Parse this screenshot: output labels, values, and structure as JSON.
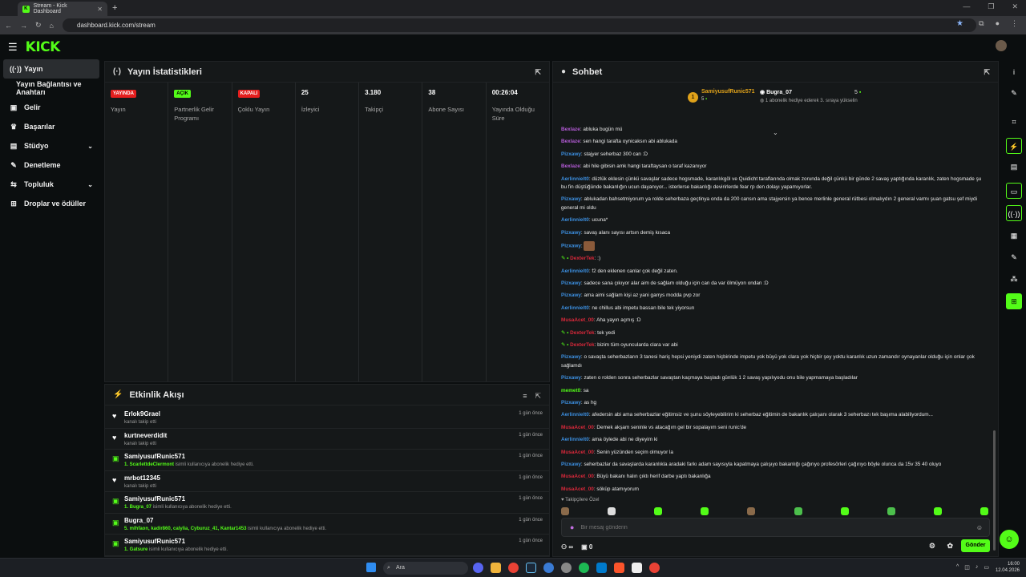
{
  "browser": {
    "tab_title": "Stream - Kick Dashboard",
    "url": "dashboard.kick.com/stream"
  },
  "header": {
    "logo": "KICK"
  },
  "sidebar": {
    "items": [
      {
        "label": "Yayın",
        "icon": "broadcast-icon"
      },
      {
        "label": "Yayın Bağlantısı ve Anahtarı"
      },
      {
        "label": "Gelir",
        "icon": "wallet-icon"
      },
      {
        "label": "Başarılar",
        "icon": "trophy-icon"
      },
      {
        "label": "Stüdyo",
        "icon": "studio-icon"
      },
      {
        "label": "Denetleme",
        "icon": "wrench-icon"
      },
      {
        "label": "Topluluk",
        "icon": "community-icon"
      },
      {
        "label": "Droplar ve ödüller",
        "icon": "gift-icon"
      }
    ]
  },
  "stats": {
    "title": "Yayın İstatistikleri",
    "cells": [
      {
        "value": "YAYINDA",
        "label": "Yayın"
      },
      {
        "value": "AÇIK",
        "label": "Partnerlik Gelir Programı"
      },
      {
        "value": "KAPALI",
        "label": "Çoklu Yayın"
      },
      {
        "value": "25",
        "label": "İzleyici"
      },
      {
        "value": "3.180",
        "label": "Takipçi"
      },
      {
        "value": "38",
        "label": "Abone Sayısı"
      },
      {
        "value": "00:26:04",
        "label": "Yayında Olduğu Süre"
      }
    ]
  },
  "activity": {
    "title": "Etkinlik Akışı",
    "items": [
      {
        "name": "Erlok9Grael",
        "pre": "",
        "desc": "kanalı takip etti",
        "time": "1 gün önce"
      },
      {
        "name": "kurtneverdidit",
        "pre": "",
        "desc": "kanalı takip etti",
        "time": "1 gün önce"
      },
      {
        "name": "SamiyusufRunic571",
        "pre": "1. ScarlettdeClermont",
        "desc": " isimli kullanıcıya abonelik hediye etti.",
        "time": "1 gün önce"
      },
      {
        "name": "mrbot12345",
        "pre": "",
        "desc": "kanalı takip etti",
        "time": "1 gün önce"
      },
      {
        "name": "SamiyusufRunic571",
        "pre": "1. Bugra_07",
        "desc": " isimli kullanıcıya abonelik hediye etti.",
        "time": "1 gün önce"
      },
      {
        "name": "Bugra_07",
        "pre": "5. mlhfaon, kadir860, calylia, Cyburuz_41, Kantar1453",
        "desc": " isimli kullanıcıya abonelik hediye etti.",
        "time": "1 gün önce"
      },
      {
        "name": "SamiyusufRunic571",
        "pre": "1. Gatsure",
        "desc": " isimli kullanıcıya abonelik hediye etti.",
        "time": "1 gün önce"
      }
    ]
  },
  "chat": {
    "title": "Sohbet",
    "pinned": {
      "left_name": "SamiyusufRunic571",
      "left_count": "5",
      "left_rank": "1",
      "right_name": "Bugra_07",
      "right_sub": "1 abonelik hediye ederek 3. sıraya yükselin",
      "right_count": "5"
    },
    "messages": [
      {
        "user": "Bexlaze",
        "color": "purple",
        "text": "abluka bugün mü"
      },
      {
        "user": "Bexlaze",
        "color": "purple",
        "text": "sen hangi tarafta oynicaksın abi ablukada"
      },
      {
        "user": "Pizxawy",
        "color": "blue",
        "text": "stajyer seherbaz 300 can :D"
      },
      {
        "user": "Bexlaze",
        "color": "purple",
        "text": "abi hile gibisin amk hangi taraftaysan o taraf kazanıyor"
      },
      {
        "user": "Aerlinnielt0",
        "color": "blue",
        "text": "düzlük eklesin çünkü savaşlar sadece hogsmade, karanlıkgöl ve Quidicht taraflarında olmak zorunda değil çünkü bir günde 2 savaş yaptığında karanlık, zaten hogsmade şu bu fin düştüğünde bakanlığın ucun dayanıyor... isterlerse bakanlığı devirirlerde fear rp den dolayı yapamıyorlar."
      },
      {
        "user": "Pizxawy",
        "color": "blue",
        "text": "ablukadan bahsetmiyorum ya rolde seherbaza geçtinya onda da 200 cansın ama stajyersin ya bence merlinle general rütbesi olmalıydın 2 general varmı şuan gatsu şef miydi general mi oldu"
      },
      {
        "user": "Aerlinnielt0",
        "color": "blue",
        "text": "ucuna*"
      },
      {
        "user": "Pizxawy",
        "color": "blue",
        "text": "savaş alanı sayısı artsın demiş kısaca"
      },
      {
        "user": "Pizxawy",
        "color": "blue",
        "text": "",
        "emote": true
      },
      {
        "user": "DexterTek",
        "color": "red",
        "text": ":)",
        "badge": true
      },
      {
        "user": "Aerlinnielt0",
        "color": "blue",
        "text": "f2 den eklenen canlar çok değil zaten."
      },
      {
        "user": "Pizxawy",
        "color": "blue",
        "text": "sadece sana çıkıyor alar aim de sağlam olduğu için can da var ölmüyon ondan :D"
      },
      {
        "user": "Pizxawy",
        "color": "blue",
        "text": "ama aimi sağlam kişi az yani garrys modda pvp zor"
      },
      {
        "user": "Aerlinnielt0",
        "color": "blue",
        "text": "ne chillus abi impetu bassan bile tek yiyorsun"
      },
      {
        "user": "MusaAcet_00",
        "color": "red",
        "text": "Aha yayın açmış :D"
      },
      {
        "user": "DexterTek",
        "color": "red",
        "text": "tek yedi",
        "badge": true
      },
      {
        "user": "DexterTek",
        "color": "red",
        "text": "bizim tüm oyuncularda clara var abi",
        "badge": true
      },
      {
        "user": "Pizxawy",
        "color": "blue",
        "text": "o savaşta seherbazların 3 tanesi hariç hepsi yeniydi zaten hiçbirinde impetu yok büyü yok clara yok hiçbir şey yoktu karanlık uzun zamandır oynayanlar olduğu için onlar çok sağlamdı"
      },
      {
        "user": "Pizxawy",
        "color": "blue",
        "text": "zaten o rolden sonra seherbazlar savaştan kaçmaya başladı günlük 1 2 savaş yapılıyodu onu bile yapmamaya başladılar"
      },
      {
        "user": "memet0",
        "color": "green",
        "text": "sa"
      },
      {
        "user": "Pizxawy",
        "color": "blue",
        "text": "as hg"
      },
      {
        "user": "Aerlinnielt0",
        "color": "blue",
        "text": "afedersin abi ama seherbazlar eğitimsiz ve şunu söyleyebilirim ki seherbaz eğitimin de bakanlık çalışanı olarak 3 seherbazı tek başıma alabiliyordum..."
      },
      {
        "user": "MusaAcet_00",
        "color": "red",
        "text": "Demek akşam seninle vs atacağım gel bir sopalayım seni runic'de"
      },
      {
        "user": "Aerlinnielt0",
        "color": "blue",
        "text": "ama öylede abi ne diyeyim ki"
      },
      {
        "user": "MusaAcet_00",
        "color": "red",
        "text": "Senin yüzünden seçim olmuyor la"
      },
      {
        "user": "Pizxawy",
        "color": "blue",
        "text": "seherbazlar da savaşlarda karanlıkla aradaki farkı adam sayısıyla kapatmaya çalışıyo bakanlığı çağırıyo profesörleri çağırıyo böyle olunca da 15v 35 40 oluyo"
      },
      {
        "user": "MusaAcet_00",
        "color": "red",
        "text": "Büyü bakanı halın çıktı herif darbe yaptı bakanlığa"
      },
      {
        "user": "MusaAcet_00",
        "color": "red",
        "text": "söküp atamıyorum"
      }
    ],
    "follow_label": "Takipçilere Özel",
    "input_placeholder": "Bir mesaj gönderin",
    "infinity": "∞",
    "points": "0",
    "send_label": "Gönder"
  },
  "taskbar": {
    "search": "Ara",
    "time": "16:00",
    "date": "12.04.2026"
  }
}
